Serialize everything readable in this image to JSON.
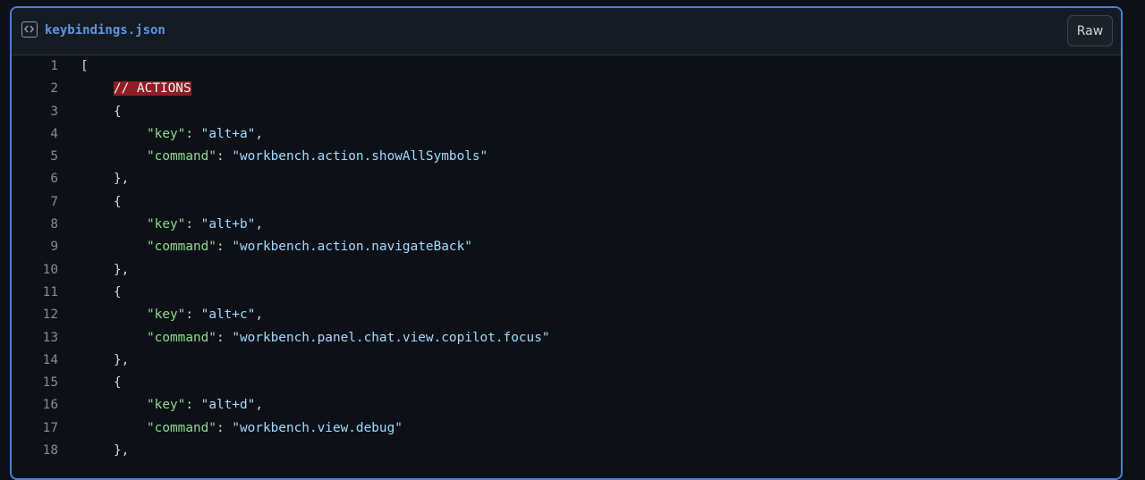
{
  "header": {
    "file_name": "keybindings.json",
    "raw_label": "Raw"
  },
  "code": {
    "lines": [
      {
        "num": "1",
        "type": "plain",
        "indent": 0,
        "text": "["
      },
      {
        "num": "2",
        "type": "comment",
        "indent": 1,
        "text": "// ACTIONS"
      },
      {
        "num": "3",
        "type": "plain",
        "indent": 1,
        "text": "{"
      },
      {
        "num": "4",
        "type": "kv",
        "indent": 2,
        "key": "\"key\"",
        "sep": ": ",
        "value": "\"alt+a\"",
        "tail": ","
      },
      {
        "num": "5",
        "type": "kv",
        "indent": 2,
        "key": "\"command\"",
        "sep": ": ",
        "value": "\"workbench.action.showAllSymbols\"",
        "tail": ""
      },
      {
        "num": "6",
        "type": "plain",
        "indent": 1,
        "text": "},"
      },
      {
        "num": "7",
        "type": "plain",
        "indent": 1,
        "text": "{"
      },
      {
        "num": "8",
        "type": "kv",
        "indent": 2,
        "key": "\"key\"",
        "sep": ": ",
        "value": "\"alt+b\"",
        "tail": ","
      },
      {
        "num": "9",
        "type": "kv",
        "indent": 2,
        "key": "\"command\"",
        "sep": ": ",
        "value": "\"workbench.action.navigateBack\"",
        "tail": ""
      },
      {
        "num": "10",
        "type": "plain",
        "indent": 1,
        "text": "},"
      },
      {
        "num": "11",
        "type": "plain",
        "indent": 1,
        "text": "{"
      },
      {
        "num": "12",
        "type": "kv",
        "indent": 2,
        "key": "\"key\"",
        "sep": ": ",
        "value": "\"alt+c\"",
        "tail": ","
      },
      {
        "num": "13",
        "type": "kv",
        "indent": 2,
        "key": "\"command\"",
        "sep": ": ",
        "value": "\"workbench.panel.chat.view.copilot.focus\"",
        "tail": ""
      },
      {
        "num": "14",
        "type": "plain",
        "indent": 1,
        "text": "},"
      },
      {
        "num": "15",
        "type": "plain",
        "indent": 1,
        "text": "{"
      },
      {
        "num": "16",
        "type": "kv",
        "indent": 2,
        "key": "\"key\"",
        "sep": ": ",
        "value": "\"alt+d\"",
        "tail": ","
      },
      {
        "num": "17",
        "type": "kv",
        "indent": 2,
        "key": "\"command\"",
        "sep": ": ",
        "value": "\"workbench.view.debug\"",
        "tail": ""
      },
      {
        "num": "18",
        "type": "plain",
        "indent": 1,
        "text": "},"
      }
    ]
  }
}
